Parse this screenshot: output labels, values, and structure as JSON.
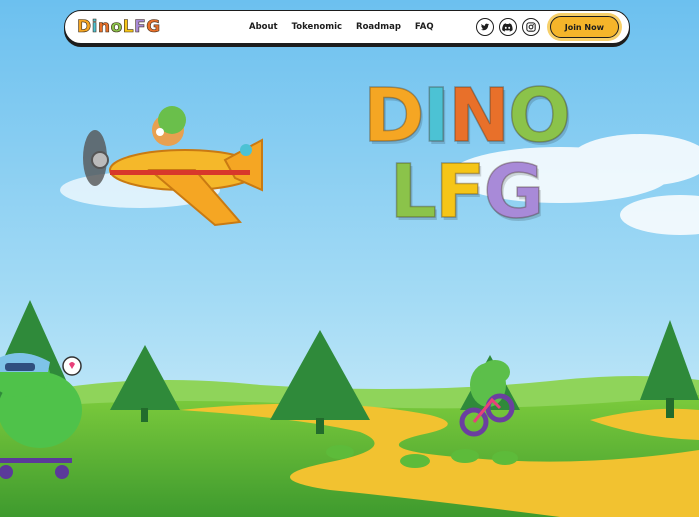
{
  "nav": {
    "logo_text": "DinoLFG",
    "logo_letters": [
      "D",
      "i",
      "n",
      "o",
      "L",
      "F",
      "G"
    ],
    "menu": [
      "About",
      "Tokenomic",
      "Roadmap",
      "FAQ"
    ],
    "socials": [
      "twitter-icon",
      "discord-icon",
      "instagram-icon"
    ],
    "join_label": "Join Now"
  },
  "hero": {
    "title_line1": [
      "D",
      "I",
      "N",
      "O"
    ],
    "title_line2": [
      "L",
      "F",
      "G"
    ]
  },
  "colors": {
    "sky": "#7cc8ef",
    "grass": "#5cb83a",
    "path": "#f2c230",
    "accent_orange": "#f5a623",
    "accent_teal": "#4cc2d4",
    "accent_green": "#8bc34a",
    "accent_purple": "#a88ad8"
  }
}
